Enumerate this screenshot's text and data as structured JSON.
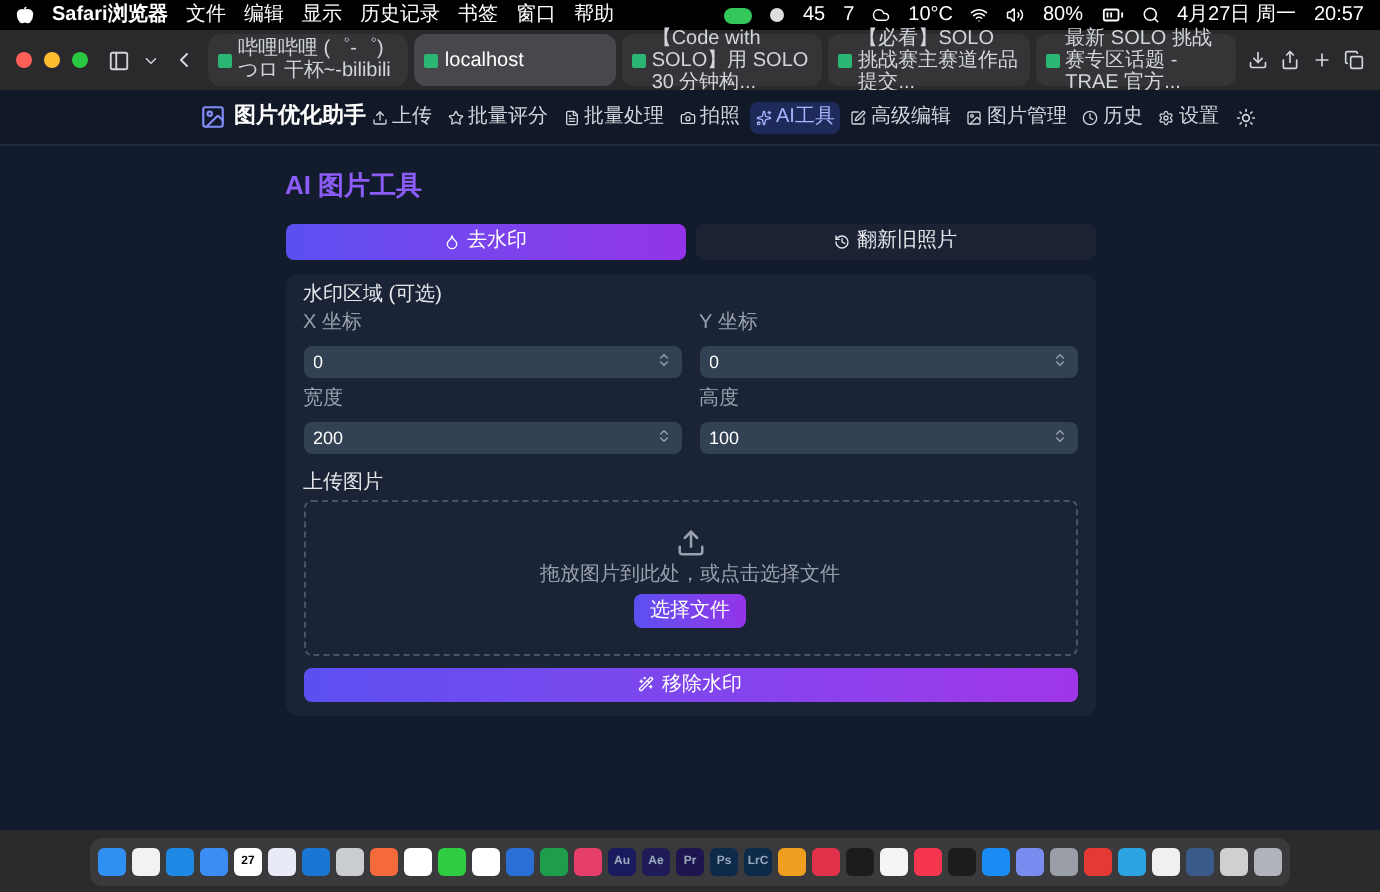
{
  "menu_bar": {
    "app": "Safari浏览器",
    "menus": [
      "文件",
      "编辑",
      "显示",
      "历史记录",
      "书签",
      "窗口",
      "帮助"
    ],
    "status": {
      "wechat_count": "45",
      "notes_count": "7",
      "weather": "10°C",
      "battery": "80%",
      "date": "4月27日 周一",
      "time": "20:57"
    }
  },
  "browser": {
    "tabs": [
      {
        "title": "哔哩哔哩 (゜-゜)つロ 干杯~-bilibili",
        "selected": false
      },
      {
        "title": "localhost",
        "selected": true
      },
      {
        "title": "【Code with SOLO】用 SOLO 30 分钟构...",
        "selected": false
      },
      {
        "title": "【必看】SOLO 挑战赛主赛道作品提交...",
        "selected": false
      },
      {
        "title": "最新 SOLO 挑战赛专区话题 - TRAE 官方...",
        "selected": false
      }
    ]
  },
  "app": {
    "brand": "图片优化助手",
    "nav": [
      {
        "label": "上传",
        "selected": false
      },
      {
        "label": "批量评分",
        "selected": false
      },
      {
        "label": "批量处理",
        "selected": false
      },
      {
        "label": "拍照",
        "selected": false
      },
      {
        "label": "AI工具",
        "selected": true
      },
      {
        "label": "高级编辑",
        "selected": false
      },
      {
        "label": "图片管理",
        "selected": false
      },
      {
        "label": "历史",
        "selected": false
      },
      {
        "label": "设置",
        "selected": false
      }
    ]
  },
  "page": {
    "title": "AI 图片工具",
    "tool_tabs": [
      {
        "label": "去水印",
        "selected": true
      },
      {
        "label": "翻新旧照片",
        "selected": false
      }
    ],
    "region": {
      "heading": "水印区域 (可选)",
      "fields": [
        {
          "label": "X 坐标",
          "value": "0"
        },
        {
          "label": "Y 坐标",
          "value": "0"
        },
        {
          "label": "宽度",
          "value": "200"
        },
        {
          "label": "高度",
          "value": "100"
        }
      ]
    },
    "upload": {
      "label": "上传图片",
      "hint": "拖放图片到此处，或点击选择文件",
      "button": "选择文件"
    },
    "submit": "移除水印"
  },
  "dock": {
    "apps": [
      {
        "color": "#2f8ff0"
      },
      {
        "color": "#f2f2f2"
      },
      {
        "color": "#1e88e5"
      },
      {
        "color": "#3b8df5"
      },
      {
        "color": "#ffffff",
        "label": "27"
      },
      {
        "color": "#e8eaf6"
      },
      {
        "color": "#1976d2"
      },
      {
        "color": "#c9ccd1"
      },
      {
        "color": "#f46a3a"
      },
      {
        "color": "#ffffff"
      },
      {
        "color": "#2ecc40"
      },
      {
        "color": "#ffffff"
      },
      {
        "color": "#2a6fd6"
      },
      {
        "color": "#1e9e4a"
      },
      {
        "color": "#e53e6a"
      },
      {
        "color": "#1a1a5e",
        "label": "Au"
      },
      {
        "color": "#1f1b59",
        "label": "Ae"
      },
      {
        "color": "#1e1550",
        "label": "Pr"
      },
      {
        "color": "#0d2a4a",
        "label": "Ps"
      },
      {
        "color": "#0d2a4a",
        "label": "LrC"
      },
      {
        "color": "#f0a020"
      },
      {
        "color": "#e0304a"
      },
      {
        "color": "#1c1c1c"
      },
      {
        "color": "#f5f5f5"
      },
      {
        "color": "#f5364e"
      },
      {
        "color": "#1c1c1c"
      },
      {
        "color": "#1a8cf5"
      },
      {
        "color": "#7a8cf0"
      },
      {
        "color": "#9a9ea6"
      },
      {
        "color": "#e53935"
      },
      {
        "color": "#2aa3e0"
      },
      {
        "color": "#f0f0f0"
      },
      {
        "color": "#3a5a8a"
      },
      {
        "color": "#d0d0d0"
      },
      {
        "color": "#b0b4ba"
      }
    ]
  }
}
